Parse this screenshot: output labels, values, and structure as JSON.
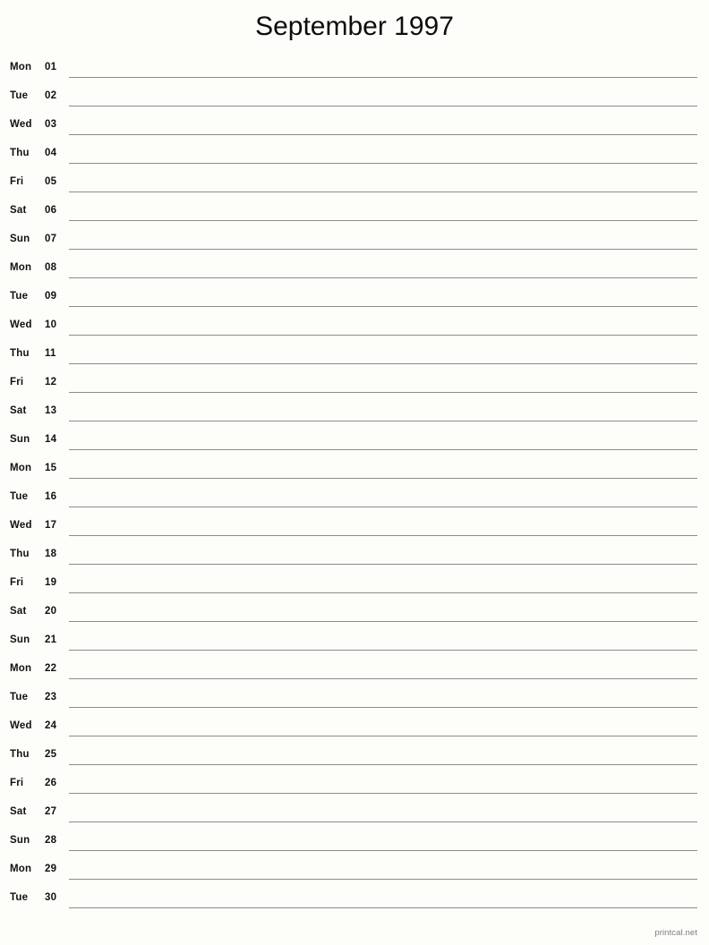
{
  "document": {
    "title": "September 1997",
    "month_name": "September",
    "year": "1997",
    "footer_credit": "printcal.net",
    "page_background_color": "#fdfdfa",
    "rule_color": "#8c8c89",
    "text_color": "#111111",
    "footer_color": "#7d7d7d"
  },
  "calendar": {
    "layout": "single-column-notepad",
    "row_count": 30,
    "rows": [
      {
        "weekday": "Mon",
        "day": "01"
      },
      {
        "weekday": "Tue",
        "day": "02"
      },
      {
        "weekday": "Wed",
        "day": "03"
      },
      {
        "weekday": "Thu",
        "day": "04"
      },
      {
        "weekday": "Fri",
        "day": "05"
      },
      {
        "weekday": "Sat",
        "day": "06"
      },
      {
        "weekday": "Sun",
        "day": "07"
      },
      {
        "weekday": "Mon",
        "day": "08"
      },
      {
        "weekday": "Tue",
        "day": "09"
      },
      {
        "weekday": "Wed",
        "day": "10"
      },
      {
        "weekday": "Thu",
        "day": "11"
      },
      {
        "weekday": "Fri",
        "day": "12"
      },
      {
        "weekday": "Sat",
        "day": "13"
      },
      {
        "weekday": "Sun",
        "day": "14"
      },
      {
        "weekday": "Mon",
        "day": "15"
      },
      {
        "weekday": "Tue",
        "day": "16"
      },
      {
        "weekday": "Wed",
        "day": "17"
      },
      {
        "weekday": "Thu",
        "day": "18"
      },
      {
        "weekday": "Fri",
        "day": "19"
      },
      {
        "weekday": "Sat",
        "day": "20"
      },
      {
        "weekday": "Sun",
        "day": "21"
      },
      {
        "weekday": "Mon",
        "day": "22"
      },
      {
        "weekday": "Tue",
        "day": "23"
      },
      {
        "weekday": "Wed",
        "day": "24"
      },
      {
        "weekday": "Thu",
        "day": "25"
      },
      {
        "weekday": "Fri",
        "day": "26"
      },
      {
        "weekday": "Sat",
        "day": "27"
      },
      {
        "weekday": "Sun",
        "day": "28"
      },
      {
        "weekday": "Mon",
        "day": "29"
      },
      {
        "weekday": "Tue",
        "day": "30"
      }
    ]
  }
}
